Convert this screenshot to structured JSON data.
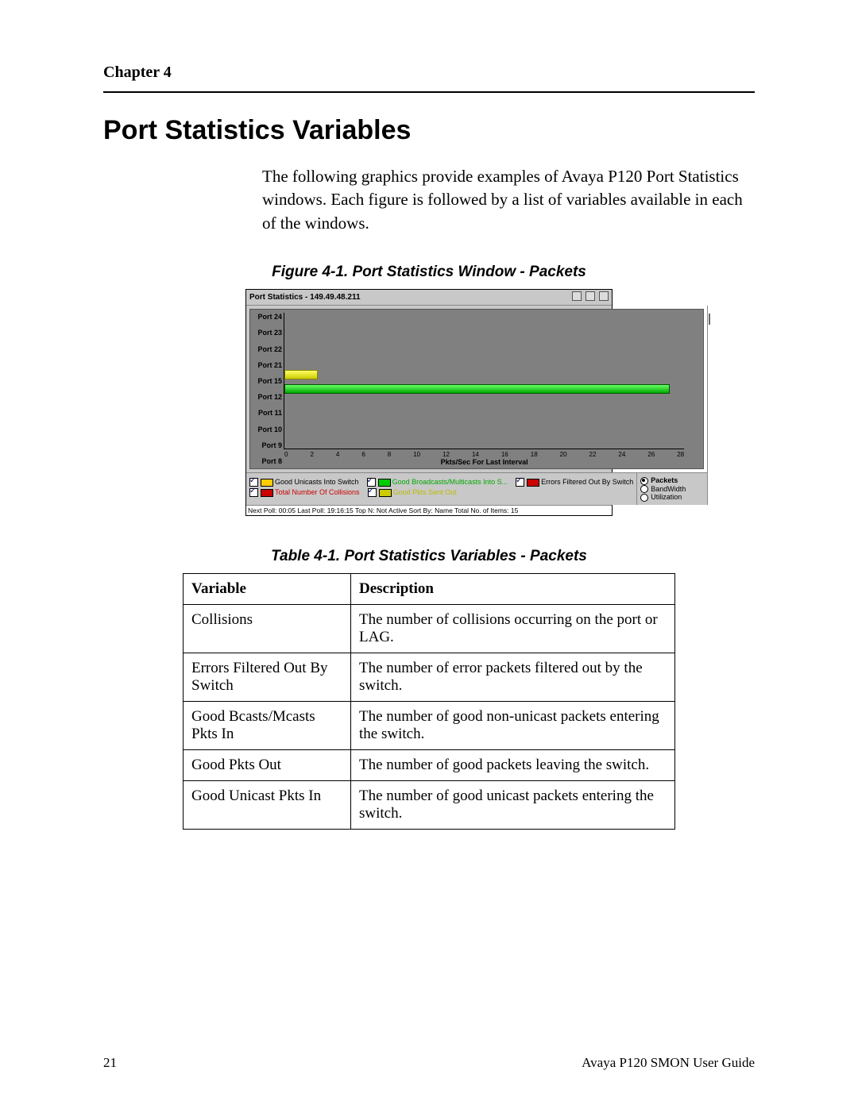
{
  "chapter": "Chapter 4",
  "heading": "Port Statistics Variables",
  "intro": "The following graphics provide examples of Avaya P120 Port Statistics windows. Each figure is followed by a list of variables available in each of the windows.",
  "figure_caption": "Figure 4-1.  Port Statistics Window - Packets",
  "table_caption": "Table 4-1.  Port Statistics Variables - Packets",
  "table": {
    "headers": {
      "variable": "Variable",
      "description": "Description"
    },
    "rows": [
      {
        "variable": "Collisions",
        "description": "The number of collisions occurring on the port or LAG."
      },
      {
        "variable": "Errors Filtered Out By Switch",
        "description": "The number of error packets filtered out by the switch."
      },
      {
        "variable": "Good Bcasts/Mcasts Pkts In",
        "description": "The number of good non-unicast packets entering the switch."
      },
      {
        "variable": "Good Pkts Out",
        "description": "The number of good packets leaving the switch."
      },
      {
        "variable": "Good Unicast Pkts In",
        "description": "The number of good unicast packets entering the switch."
      }
    ]
  },
  "screenshot": {
    "title": "Port Statistics - 149.49.48.211",
    "xlabel": "Pkts/Sec For Last Interval",
    "xticks": [
      "0",
      "2",
      "4",
      "6",
      "8",
      "10",
      "12",
      "14",
      "16",
      "18",
      "20",
      "22",
      "24",
      "26",
      "28"
    ],
    "ports": [
      "Port 24",
      "Port 23",
      "Port 22",
      "Port 21",
      "Port 15",
      "Port 12",
      "Port 11",
      "Port 10",
      "Port 9",
      "Port 8"
    ],
    "legend": {
      "l1": "Good Unicasts Into Switch",
      "l2": "Good Broadcasts/Multicasts Into S...",
      "l3": "Errors Filtered Out By Switch",
      "l4": "Total Number Of Collisions",
      "l5": "Good Pkts Sent Out"
    },
    "modes": {
      "packets": "Packets",
      "bandwidth": "BandWidth",
      "utilization": "Utilization"
    },
    "status": "Next Poll:  00:05   Last Poll: 19:16:15   Top N: Not Active   Sort By: Name   Total No. of Items: 15"
  },
  "chart_data": {
    "type": "bar",
    "orientation": "horizontal",
    "xlabel": "Pkts/Sec For Last Interval",
    "xlim": [
      0,
      28
    ],
    "categories": [
      "Port 24",
      "Port 23",
      "Port 22",
      "Port 21",
      "Port 15",
      "Port 12",
      "Port 11",
      "Port 10",
      "Port 9",
      "Port 8"
    ],
    "series": [
      {
        "name": "Good Unicasts Into Switch",
        "color": "yellow",
        "values": [
          0,
          0,
          0,
          0,
          2,
          0,
          0,
          0,
          0,
          0
        ]
      },
      {
        "name": "Good Broadcasts/Multicasts Into Switch",
        "color": "green",
        "values": [
          0,
          0,
          0,
          0,
          0,
          27,
          0,
          0,
          0,
          0
        ]
      }
    ]
  },
  "footer": {
    "page": "21",
    "doc": "Avaya P120 SMON User Guide"
  }
}
